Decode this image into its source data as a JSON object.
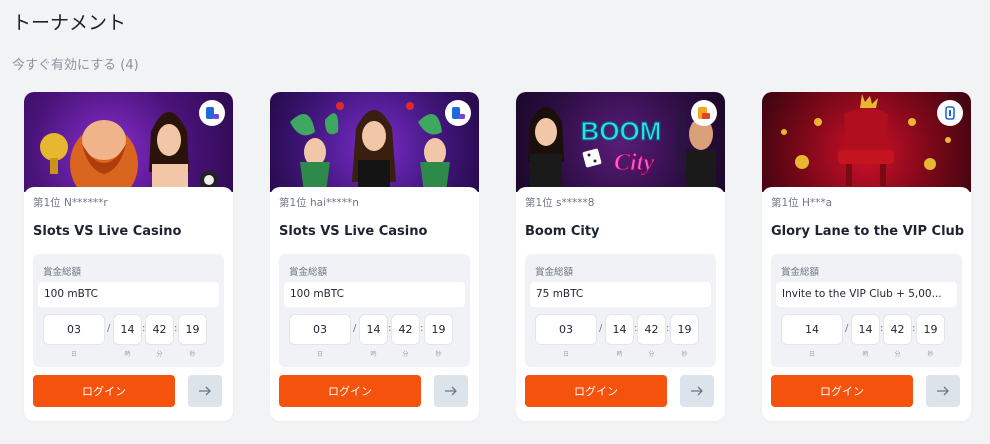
{
  "page": {
    "title": "トーナメント",
    "subtitle": "今すぐ有効にする (4)"
  },
  "colors": {
    "accent": "#f5520d",
    "background": "#f2f3f5",
    "card": "#ffffff",
    "arrow_button": "#dde3ea"
  },
  "cards": [
    {
      "banner_icon": "game-banner-image",
      "provider_icon": "provider-badge-icon",
      "rank": "第1位 N******r",
      "name": "Slots VS Live Casino",
      "prize_label": "賞金総額",
      "prize": "100 mBTC",
      "timer": {
        "days": "03",
        "hours": "14",
        "minutes": "42",
        "seconds": "19"
      },
      "timer_units": {
        "days": "日",
        "hours": "時",
        "minutes": "分",
        "seconds": "秒"
      },
      "separators": {
        "date": "/",
        "time": ":"
      },
      "login_label": "ログイン",
      "arrow_icon": "arrow-right-icon"
    },
    {
      "banner_icon": "game-banner-image",
      "provider_icon": "provider-badge-icon",
      "rank": "第1位 hai*****n",
      "name": "Slots VS Live Casino",
      "prize_label": "賞金総額",
      "prize": "100 mBTC",
      "timer": {
        "days": "03",
        "hours": "14",
        "minutes": "42",
        "seconds": "19"
      },
      "timer_units": {
        "days": "日",
        "hours": "時",
        "minutes": "分",
        "seconds": "秒"
      },
      "separators": {
        "date": "/",
        "time": ":"
      },
      "login_label": "ログイン",
      "arrow_icon": "arrow-right-icon"
    },
    {
      "banner_icon": "game-banner-image",
      "provider_icon": "provider-badge-icon",
      "rank": "第1位 s*****8",
      "name": "Boom City",
      "prize_label": "賞金総額",
      "prize": "75 mBTC",
      "timer": {
        "days": "03",
        "hours": "14",
        "minutes": "42",
        "seconds": "19"
      },
      "timer_units": {
        "days": "日",
        "hours": "時",
        "minutes": "分",
        "seconds": "秒"
      },
      "separators": {
        "date": "/",
        "time": ":"
      },
      "login_label": "ログイン",
      "arrow_icon": "arrow-right-icon"
    },
    {
      "banner_icon": "game-banner-image",
      "provider_icon": "provider-badge-icon",
      "rank": "第1位 H***a",
      "name": "Glory Lane to the VIP Club",
      "prize_label": "賞金総額",
      "prize": "Invite to the VIP Club + 5,00...",
      "timer": {
        "days": "14",
        "hours": "14",
        "minutes": "42",
        "seconds": "19"
      },
      "timer_units": {
        "days": "日",
        "hours": "時",
        "minutes": "分",
        "seconds": "秒"
      },
      "separators": {
        "date": "/",
        "time": ":"
      },
      "login_label": "ログイン",
      "arrow_icon": "arrow-right-icon"
    }
  ]
}
